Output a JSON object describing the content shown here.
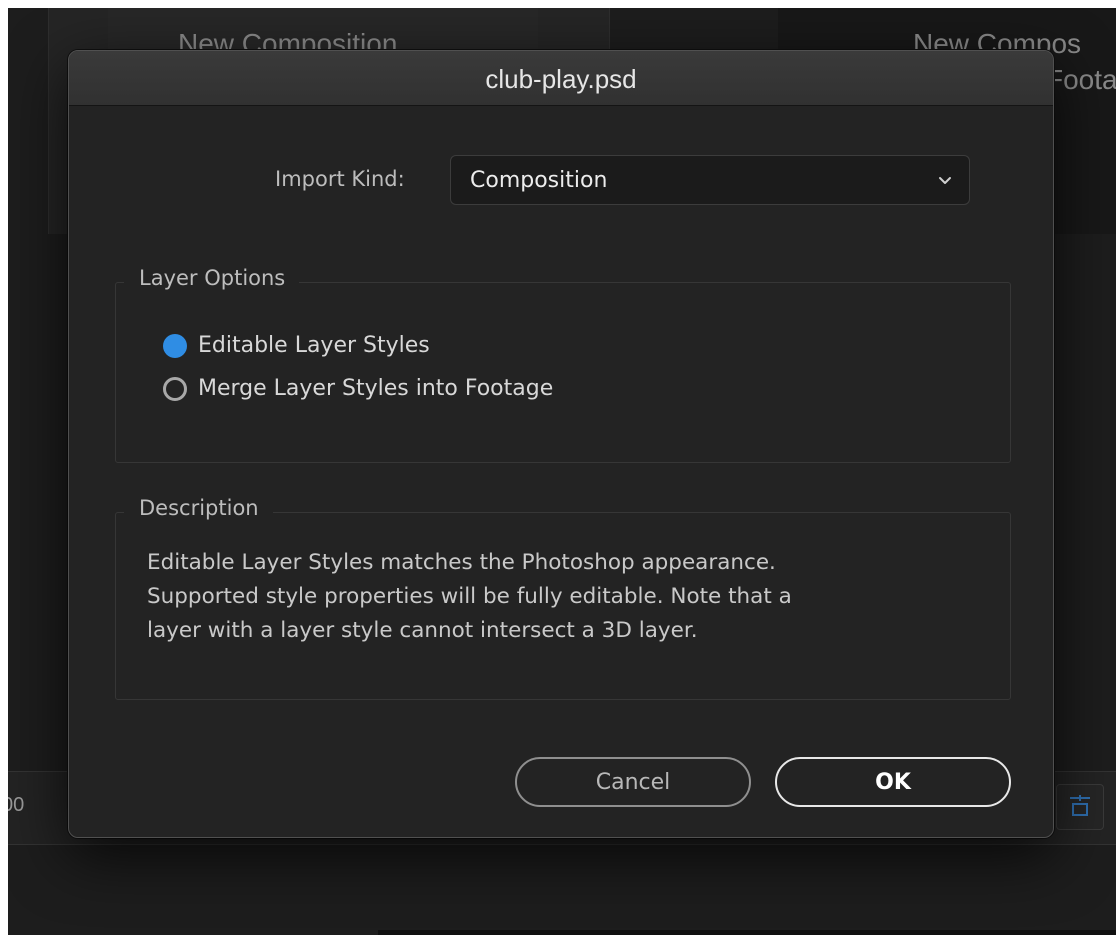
{
  "background": {
    "left_panel_title": "New Composition",
    "right_panel_title_line1": "New Compos",
    "right_panel_title_line2": "Foota",
    "timeline_number": "00"
  },
  "dialog": {
    "title": "club-play.psd",
    "import_kind": {
      "label": "Import Kind:",
      "selected_value": "Composition"
    },
    "layer_options": {
      "legend": "Layer Options",
      "options": [
        {
          "label": "Editable Layer Styles",
          "selected": true
        },
        {
          "label": "Merge Layer Styles into Footage",
          "selected": false
        }
      ]
    },
    "description": {
      "legend": "Description",
      "lines": [
        "Editable Layer Styles matches the Photoshop appearance.",
        "Supported style properties will be fully editable. Note that a",
        "layer with a layer style cannot intersect a 3D layer."
      ]
    },
    "buttons": {
      "cancel": "Cancel",
      "ok": "OK"
    }
  },
  "colors": {
    "accent_radio": "#2f8de4",
    "dialog_bg": "#232323",
    "titlebar_bg": "#353535"
  },
  "icons": {
    "select_chevron": "chevron-down-icon",
    "bg_tool": "frame-tool-icon"
  }
}
